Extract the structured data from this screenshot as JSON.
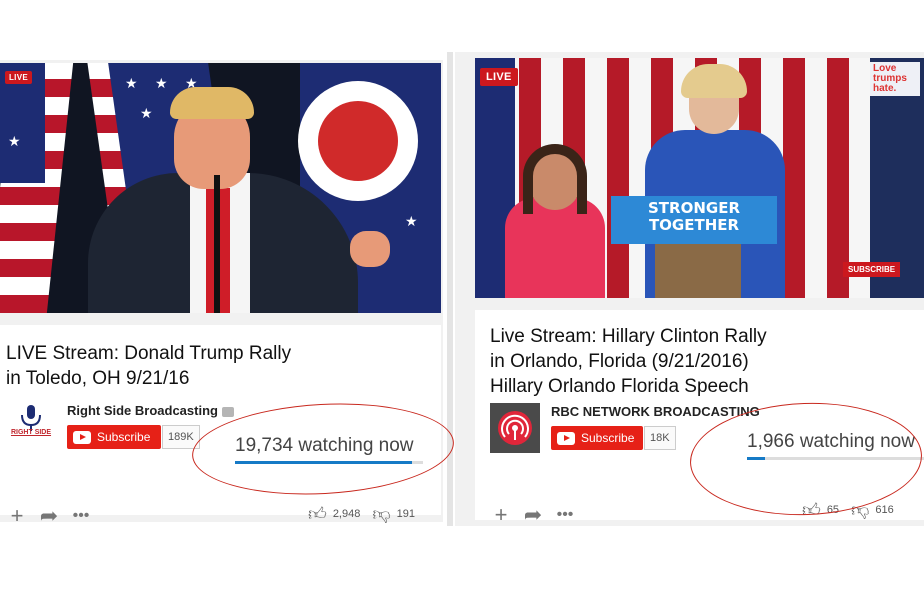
{
  "left_video": {
    "live_badge": "LIVE",
    "title_line1": "LIVE Stream: Donald Trump Rally",
    "title_line2": "in Toledo, OH 9/21/16",
    "channel_name": "Right Side Broadcasting",
    "avatar_text": "RIGHT SIDE",
    "subscribe_label": "Subscribe",
    "subscriber_count": "189K",
    "watching": "19,734 watching now",
    "likes": "2,948",
    "dislikes": "191"
  },
  "right_video": {
    "live_badge": "LIVE",
    "podium_line1": "STRONGER",
    "podium_line2": "TOGETHER",
    "sign_text": "Love trumps hate.",
    "watermark": "SUBSCRIBE",
    "title_line1": "Live Stream: Hillary Clinton Rally",
    "title_line2": "in Orlando, Florida (9/21/2016)",
    "title_line3": "Hillary Orlando Florida Speech",
    "channel_name": "RBC NETWORK BROADCASTING",
    "subscribe_label": "Subscribe",
    "subscriber_count": "18K",
    "watching": "1,966 watching now",
    "likes": "65",
    "dislikes": "616"
  },
  "icons": {
    "add": "add-icon",
    "share": "share-icon",
    "more": "more-icon",
    "like": "thumbs-up-icon",
    "dislike": "thumbs-down-icon"
  },
  "colors": {
    "youtube_red": "#e62117",
    "progress_blue": "#167ac6",
    "annotation_red": "#c8281e"
  }
}
